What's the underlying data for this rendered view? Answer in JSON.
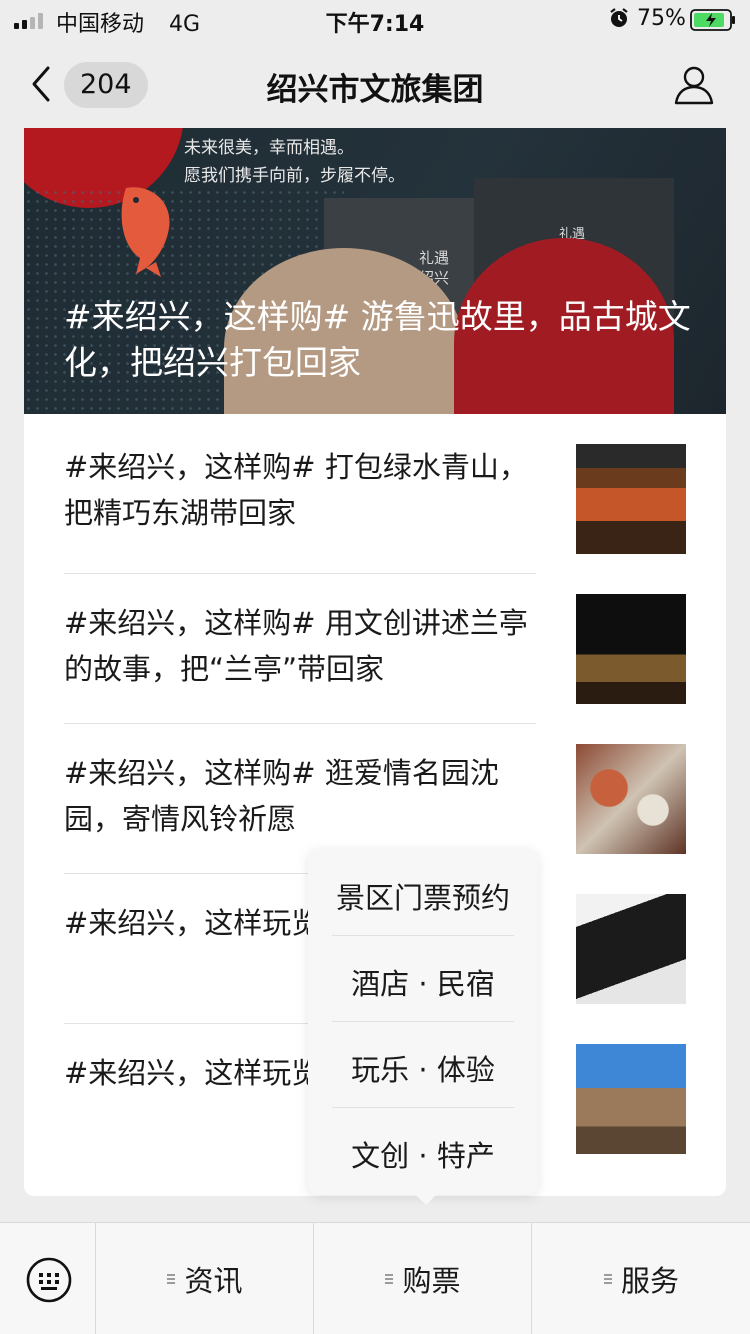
{
  "status_bar": {
    "carrier": "中国移动",
    "network": "4G",
    "time": "下午7:14",
    "battery": "75%"
  },
  "nav": {
    "badge_count": "204",
    "title": "绍兴市文旅集团"
  },
  "hero": {
    "tagline_1": "未来很美，幸而相遇。",
    "tagline_2": "愿我们携手向前，步履不停。",
    "title": "#来绍兴，这样购# 游鲁迅故里，品古城文化，把绍兴打包回家"
  },
  "articles": [
    {
      "title": "#来绍兴，这样购# 打包绿水青山，把精巧东湖带回家"
    },
    {
      "title": "#来绍兴，这样购# 用文创讲述兰亭的故事，把“兰亭”带回家"
    },
    {
      "title": "#来绍兴，这样购# 逛爱情名园沈园，寄情风铃祈愿"
    },
    {
      "title": "#来绍兴，这样玩览绍兴名人故居"
    },
    {
      "title": "#来绍兴，这样玩览 书圣故里"
    }
  ],
  "popup_menu": {
    "items": [
      "景区门票预约",
      "酒店 · 民宿",
      "玩乐 · 体验",
      "文创 · 特产"
    ]
  },
  "bottom_menu": {
    "items": [
      "资讯",
      "购票",
      "服务"
    ]
  },
  "colors": {
    "background": "#ededed",
    "hero_red": "#b3191f",
    "hero_dark": "#1e2b33"
  }
}
